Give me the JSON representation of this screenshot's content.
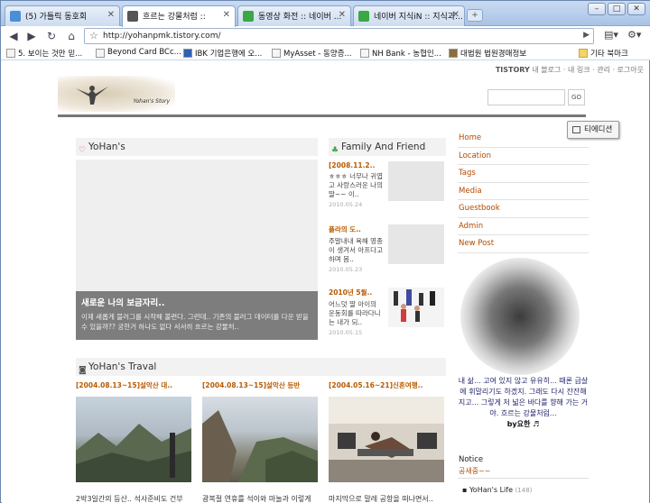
{
  "browser": {
    "tabs": [
      {
        "label": "(5) 가틀릭 동호회",
        "color": "#4a8fd6"
      },
      {
        "label": "흐르는 강물처럼 ::",
        "color": "#555555"
      },
      {
        "label": "동영상 화전 :: 네이버 ...",
        "color": "#3aa845"
      },
      {
        "label": "네이버 지식iN :: 지식과...",
        "color": "#3aa845"
      }
    ],
    "url": "http://yohanpmk.tistory.com/",
    "bookmarks": [
      "5. 보이는 것만 믿...",
      "Beyond Card BCc...",
      "IBK 기업은행에 오...",
      "MyAsset - 동양증...",
      "NH Bank - 농협인...",
      "대법원 법원경매정보",
      "기타 북마크"
    ]
  },
  "page": {
    "topbar": {
      "brand": "TISTORY",
      "links": "내 블로그 · 내 링크 · 관리 · 로그아웃"
    },
    "banner_tag": "Yohan's Story",
    "search_go": "GO",
    "editor_button": "티에디션",
    "sections": {
      "yohan": "YoHan's",
      "family": "Family And Friend",
      "travel": "YoHan's Traval"
    },
    "feature": {
      "title": "새로운 나의 보금자리..",
      "desc": "이제 새롭게 블러그를 시작해 볼련다. 그런데.. 기존의 블러그 데이터를 다운 받을 수 있을까?? 궁한거 하나도 없다 서서히 흐르는 강물처.."
    },
    "friends": [
      {
        "title": "[2008.11.2..",
        "text": "ㅎㅎㅎ 너무나 귀엽고 사랑스러운 나의 딸~~ 이..",
        "date": "2010.05.24"
      },
      {
        "title": "플라의 도..",
        "text": "주말내내 욕해 영종이 생겨서 아프다고 하며 몸..",
        "date": "2010.05.23"
      },
      {
        "title": "2010년 5월..",
        "text": "어느덧 딸 아이의 운동회를 따라다니는 내가 되..",
        "date": "2010.05.15"
      }
    ],
    "menu": [
      "Home",
      "Location",
      "Tags",
      "Media",
      "Guestbook",
      "Admin",
      "New Post"
    ],
    "profile_text": "내 삶... 고여 있지 않고 유유히... 때론 급살에 휘말리기도 하겠지. 그래도 다시 잔잔해 지고... 그렇게 저 넓은 바다를 향해 가는 거야. 흐르는 강물처럼...",
    "profile_sig": "by요한 ♬",
    "notice": {
      "head": "Notice",
      "body": "공새중~~"
    },
    "life": {
      "label": "YoHan's Life",
      "count": "(148)"
    },
    "travels": [
      {
        "title": "[2004.08.13~15]설악산 대..",
        "caption": "2박3일간의 등산.. 석사준비도 건부"
      },
      {
        "title": "[2004.08.13~15]설악산 등반",
        "caption": "광복절 연휴를 석이와 마눌과 이렇게"
      },
      {
        "title": "[2004.05.16~21]신혼여행..",
        "caption": "마지막으로 말레 공항을 떠나면서.."
      }
    ]
  }
}
